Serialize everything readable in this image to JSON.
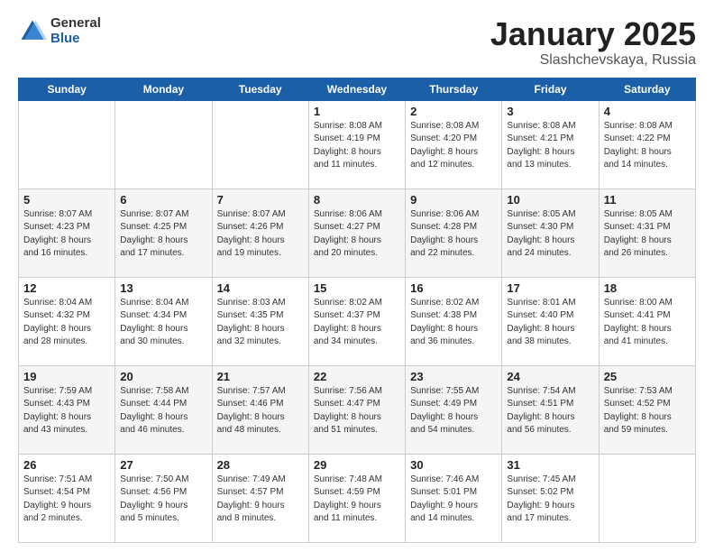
{
  "header": {
    "logo_general": "General",
    "logo_blue": "Blue",
    "title": "January 2025",
    "location": "Slashchevskaya, Russia"
  },
  "weekdays": [
    "Sunday",
    "Monday",
    "Tuesday",
    "Wednesday",
    "Thursday",
    "Friday",
    "Saturday"
  ],
  "weeks": [
    [
      {
        "day": "",
        "info": ""
      },
      {
        "day": "",
        "info": ""
      },
      {
        "day": "",
        "info": ""
      },
      {
        "day": "1",
        "info": "Sunrise: 8:08 AM\nSunset: 4:19 PM\nDaylight: 8 hours\nand 11 minutes."
      },
      {
        "day": "2",
        "info": "Sunrise: 8:08 AM\nSunset: 4:20 PM\nDaylight: 8 hours\nand 12 minutes."
      },
      {
        "day": "3",
        "info": "Sunrise: 8:08 AM\nSunset: 4:21 PM\nDaylight: 8 hours\nand 13 minutes."
      },
      {
        "day": "4",
        "info": "Sunrise: 8:08 AM\nSunset: 4:22 PM\nDaylight: 8 hours\nand 14 minutes."
      }
    ],
    [
      {
        "day": "5",
        "info": "Sunrise: 8:07 AM\nSunset: 4:23 PM\nDaylight: 8 hours\nand 16 minutes."
      },
      {
        "day": "6",
        "info": "Sunrise: 8:07 AM\nSunset: 4:25 PM\nDaylight: 8 hours\nand 17 minutes."
      },
      {
        "day": "7",
        "info": "Sunrise: 8:07 AM\nSunset: 4:26 PM\nDaylight: 8 hours\nand 19 minutes."
      },
      {
        "day": "8",
        "info": "Sunrise: 8:06 AM\nSunset: 4:27 PM\nDaylight: 8 hours\nand 20 minutes."
      },
      {
        "day": "9",
        "info": "Sunrise: 8:06 AM\nSunset: 4:28 PM\nDaylight: 8 hours\nand 22 minutes."
      },
      {
        "day": "10",
        "info": "Sunrise: 8:05 AM\nSunset: 4:30 PM\nDaylight: 8 hours\nand 24 minutes."
      },
      {
        "day": "11",
        "info": "Sunrise: 8:05 AM\nSunset: 4:31 PM\nDaylight: 8 hours\nand 26 minutes."
      }
    ],
    [
      {
        "day": "12",
        "info": "Sunrise: 8:04 AM\nSunset: 4:32 PM\nDaylight: 8 hours\nand 28 minutes."
      },
      {
        "day": "13",
        "info": "Sunrise: 8:04 AM\nSunset: 4:34 PM\nDaylight: 8 hours\nand 30 minutes."
      },
      {
        "day": "14",
        "info": "Sunrise: 8:03 AM\nSunset: 4:35 PM\nDaylight: 8 hours\nand 32 minutes."
      },
      {
        "day": "15",
        "info": "Sunrise: 8:02 AM\nSunset: 4:37 PM\nDaylight: 8 hours\nand 34 minutes."
      },
      {
        "day": "16",
        "info": "Sunrise: 8:02 AM\nSunset: 4:38 PM\nDaylight: 8 hours\nand 36 minutes."
      },
      {
        "day": "17",
        "info": "Sunrise: 8:01 AM\nSunset: 4:40 PM\nDaylight: 8 hours\nand 38 minutes."
      },
      {
        "day": "18",
        "info": "Sunrise: 8:00 AM\nSunset: 4:41 PM\nDaylight: 8 hours\nand 41 minutes."
      }
    ],
    [
      {
        "day": "19",
        "info": "Sunrise: 7:59 AM\nSunset: 4:43 PM\nDaylight: 8 hours\nand 43 minutes."
      },
      {
        "day": "20",
        "info": "Sunrise: 7:58 AM\nSunset: 4:44 PM\nDaylight: 8 hours\nand 46 minutes."
      },
      {
        "day": "21",
        "info": "Sunrise: 7:57 AM\nSunset: 4:46 PM\nDaylight: 8 hours\nand 48 minutes."
      },
      {
        "day": "22",
        "info": "Sunrise: 7:56 AM\nSunset: 4:47 PM\nDaylight: 8 hours\nand 51 minutes."
      },
      {
        "day": "23",
        "info": "Sunrise: 7:55 AM\nSunset: 4:49 PM\nDaylight: 8 hours\nand 54 minutes."
      },
      {
        "day": "24",
        "info": "Sunrise: 7:54 AM\nSunset: 4:51 PM\nDaylight: 8 hours\nand 56 minutes."
      },
      {
        "day": "25",
        "info": "Sunrise: 7:53 AM\nSunset: 4:52 PM\nDaylight: 8 hours\nand 59 minutes."
      }
    ],
    [
      {
        "day": "26",
        "info": "Sunrise: 7:51 AM\nSunset: 4:54 PM\nDaylight: 9 hours\nand 2 minutes."
      },
      {
        "day": "27",
        "info": "Sunrise: 7:50 AM\nSunset: 4:56 PM\nDaylight: 9 hours\nand 5 minutes."
      },
      {
        "day": "28",
        "info": "Sunrise: 7:49 AM\nSunset: 4:57 PM\nDaylight: 9 hours\nand 8 minutes."
      },
      {
        "day": "29",
        "info": "Sunrise: 7:48 AM\nSunset: 4:59 PM\nDaylight: 9 hours\nand 11 minutes."
      },
      {
        "day": "30",
        "info": "Sunrise: 7:46 AM\nSunset: 5:01 PM\nDaylight: 9 hours\nand 14 minutes."
      },
      {
        "day": "31",
        "info": "Sunrise: 7:45 AM\nSunset: 5:02 PM\nDaylight: 9 hours\nand 17 minutes."
      },
      {
        "day": "",
        "info": ""
      }
    ]
  ]
}
